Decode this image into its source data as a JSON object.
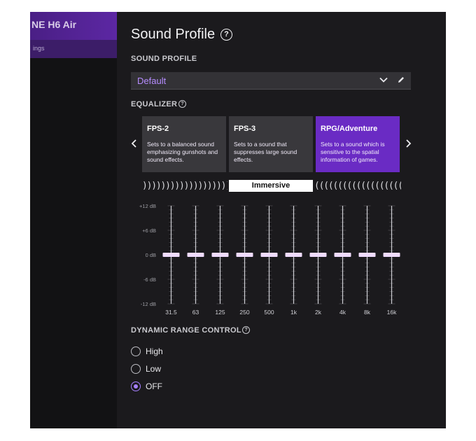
{
  "sidebar": {
    "device_title": "NE H6 Air",
    "item_label": "ings"
  },
  "page": {
    "title": "Sound Profile"
  },
  "sound_profile": {
    "section_label": "SOUND PROFILE",
    "selected": "Default"
  },
  "equalizer": {
    "section_label": "EQUALIZER",
    "presets": [
      {
        "name": "FPS-2",
        "description": "Sets to a balanced sound emphasizing gunshots and sound effects."
      },
      {
        "name": "FPS-3",
        "description": "Sets to a sound that suppresses large sound effects."
      },
      {
        "name": "RPG/Adventure",
        "description": "Sets to a sound which is sensitive to the spatial information of games."
      }
    ],
    "active_preset": "RPG/Adventure",
    "spatial_mode": "Immersive",
    "db_ticks": [
      "+12 dB",
      "+6 dB",
      "0 dB",
      "-6 dB",
      "-12 dB"
    ],
    "bands": [
      {
        "label": "31.5",
        "gain_db": 0
      },
      {
        "label": "63",
        "gain_db": 0
      },
      {
        "label": "125",
        "gain_db": 0
      },
      {
        "label": "250",
        "gain_db": 0
      },
      {
        "label": "500",
        "gain_db": 0
      },
      {
        "label": "1k",
        "gain_db": 0
      },
      {
        "label": "2k",
        "gain_db": 0
      },
      {
        "label": "4k",
        "gain_db": 0
      },
      {
        "label": "8k",
        "gain_db": 0
      },
      {
        "label": "16k",
        "gain_db": 0
      }
    ],
    "range_db": [
      -12,
      12
    ]
  },
  "dynamic_range_control": {
    "section_label": "DYNAMIC RANGE CONTROL",
    "options": [
      "High",
      "Low",
      "OFF"
    ],
    "selected": "OFF"
  },
  "colors": {
    "accent": "#6a2bc4",
    "accent_text": "#b68cff",
    "slider_knob": "#f0dcff"
  }
}
